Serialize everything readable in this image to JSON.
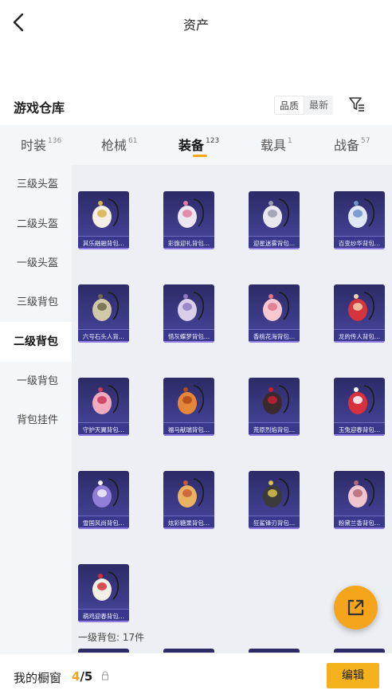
{
  "header": {
    "title": "资产"
  },
  "section": {
    "title": "游戏仓库"
  },
  "sort": {
    "options": [
      "品质",
      "最新"
    ]
  },
  "tabs": [
    {
      "label": "时装",
      "count": "136"
    },
    {
      "label": "枪械",
      "count": "61"
    },
    {
      "label": "装备",
      "count": "123"
    },
    {
      "label": "载具",
      "count": "1"
    },
    {
      "label": "战备",
      "count": "57"
    }
  ],
  "sidebar": {
    "items": [
      "三级头盔",
      "二级头盔",
      "一级头盔",
      "三级背包",
      "二级背包",
      "一级背包",
      "背包挂件"
    ]
  },
  "items": [
    {
      "name": "其乐融融背包...",
      "icon": "cake-backpack-icon"
    },
    {
      "name": "彩旗迎礼背包...",
      "icon": "flag-backpack-icon"
    },
    {
      "name": "迎星迷雾背包...",
      "icon": "mist-backpack-icon"
    },
    {
      "name": "百变纱华背包...",
      "icon": "gauze-backpack-icon"
    },
    {
      "name": "六号石头人背...",
      "icon": "stone-golem-backpack-icon"
    },
    {
      "name": "惜灰蝶梦背包...",
      "icon": "butterfly-backpack-icon"
    },
    {
      "name": "香桃花海背包...",
      "icon": "peach-backpack-icon"
    },
    {
      "name": "龙的传人背包...",
      "icon": "dragon-backpack-icon"
    },
    {
      "name": "守护天翼背包...",
      "icon": "wing-backpack-icon"
    },
    {
      "name": "福马献瑞背包...",
      "icon": "horse-backpack-icon"
    },
    {
      "name": "荒原烈焰背包...",
      "icon": "flame-backpack-icon"
    },
    {
      "name": "玉兔迎春背包...",
      "icon": "rabbit-backpack-icon"
    },
    {
      "name": "雪国风尚背包...",
      "icon": "snow-backpack-icon"
    },
    {
      "name": "炫彩糖果背包...",
      "icon": "candy-backpack-icon"
    },
    {
      "name": "狂鲨锋刃背包...",
      "icon": "shark-backpack-icon"
    },
    {
      "name": "粉黛兰香背包...",
      "icon": "orchid-backpack-icon"
    },
    {
      "name": "萌鸡迎春背包...",
      "icon": "chick-backpack-icon"
    }
  ],
  "group_label": "一级背包: 17件",
  "showcase": {
    "title": "我的橱窗",
    "current": "4",
    "total": "/5"
  },
  "edit_label": "编辑",
  "colors": {
    "accent": "#f4a51c",
    "card_bg": "#3c3a86"
  }
}
